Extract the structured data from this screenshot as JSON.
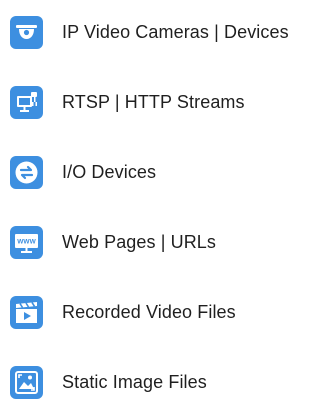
{
  "accent_color": "#3d8fe0",
  "items": [
    {
      "label": "IP Video Cameras | Devices",
      "icon": "camera-icon"
    },
    {
      "label": "RTSP | HTTP Streams",
      "icon": "network-stream-icon"
    },
    {
      "label": "I/O Devices",
      "icon": "io-exchange-icon"
    },
    {
      "label": "Web Pages | URLs",
      "icon": "web-monitor-icon"
    },
    {
      "label": "Recorded Video Files",
      "icon": "video-file-icon"
    },
    {
      "label": "Static Image Files",
      "icon": "image-file-icon"
    }
  ]
}
